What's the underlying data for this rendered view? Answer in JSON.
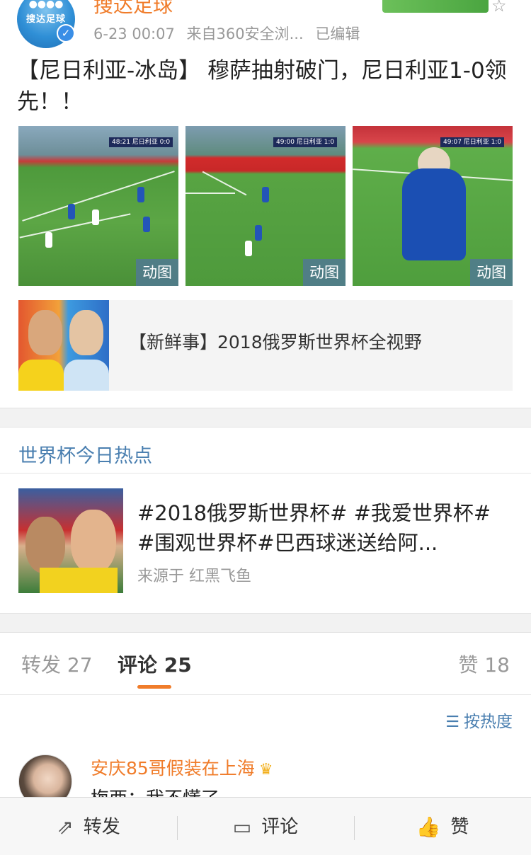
{
  "post": {
    "author": "搜达足球",
    "avatar_logo_text": "搜达足球",
    "time": "6-23 00:07",
    "source": "来自360安全浏...",
    "edited": "已编辑",
    "text": "【尼日利亚-冰岛】 穆萨抽射破门，尼日利亚1-0领先！！",
    "media": [
      {
        "tag": "动图",
        "scoreboard": "48:21 尼日利亚 0:0"
      },
      {
        "tag": "动图",
        "scoreboard": "49:00 尼日利亚 1:0"
      },
      {
        "tag": "动图",
        "scoreboard": "49:07 尼日利亚 1:0"
      }
    ],
    "link_card": {
      "title": "【新鲜事】2018俄罗斯世界杯全视野"
    }
  },
  "hot": {
    "section_title": "世界杯今日热点",
    "topic_text": "#2018俄罗斯世界杯# #我爱世界杯# #围观世界杯#巴西球迷送给阿...",
    "source": "来源于 红黑飞鱼"
  },
  "tabs": {
    "repost": "转发 27",
    "comment": "评论 25",
    "like": "赞 18"
  },
  "sort": {
    "label": "按热度"
  },
  "comment": {
    "user": "安庆85哥假装在上海",
    "text": "梅西：我不懂了"
  },
  "bottom_bar": {
    "repost": "转发",
    "comment": "评论",
    "like": "赞"
  },
  "colors": {
    "accent_orange": "#f07c2a",
    "link_blue": "#4a7fb0",
    "gif_tag": "#50789a"
  },
  "icons": [
    "star-icon",
    "verified-icon",
    "sort-icon",
    "crown-icon",
    "repost-icon",
    "comment-icon",
    "like-icon"
  ]
}
